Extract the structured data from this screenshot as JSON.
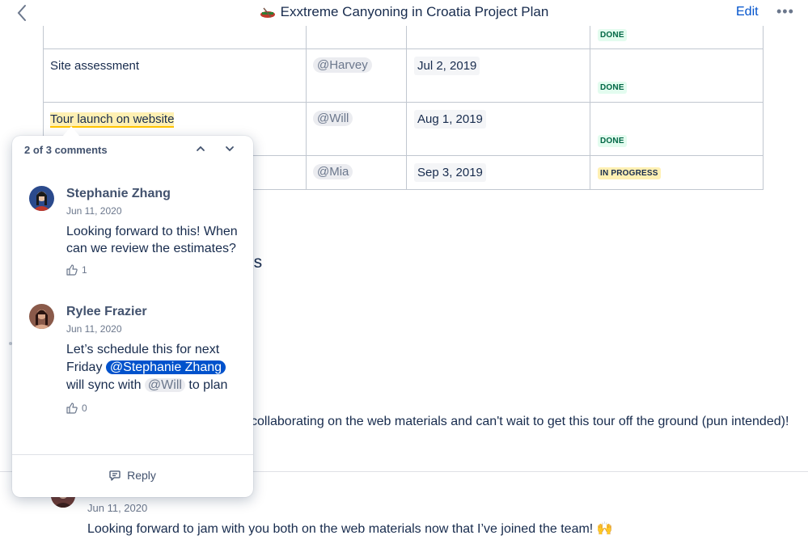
{
  "header": {
    "title": "Exxtreme Canyoning in Croatia Project Plan",
    "edit_label": "Edit",
    "more_label": "•••"
  },
  "table": {
    "rows": [
      {
        "task": "",
        "owner": "",
        "date": "",
        "status": "DONE"
      },
      {
        "task": "Site assessment",
        "owner": "@Harvey",
        "date": "Jul 2, 2019",
        "status": "DONE"
      },
      {
        "task": "Tour launch on website",
        "owner": "@Will",
        "date": "Aug 1, 2019",
        "status": "DONE"
      },
      {
        "task": "",
        "owner": "@Mia",
        "date": "Sep 3, 2019",
        "status": "IN PROGRESS"
      }
    ]
  },
  "page": {
    "partial_heading": "ls",
    "body_line": "collaborating on the web materials and can't wait to get this tour off the ground (pun intended)!",
    "bottom_comment": {
      "date": "Jun 11, 2020",
      "text": "Looking forward to jam with you both on the web materials now that I’ve joined the team! 🙌"
    }
  },
  "comments_panel": {
    "counter": "2 of 3 comments",
    "comments": [
      {
        "author": "Stephanie Zhang",
        "date": "Jun 11, 2020",
        "text": "Looking forward to this! When can we review the estimates?",
        "likes": "1"
      },
      {
        "author": "Rylee Frazier",
        "date": "Jun 11, 2020",
        "text_part1": "Let’s schedule this for next Friday",
        "mention1": "@Stephanie Zhang",
        "text_part2": "will sync with",
        "mention2": "@Will",
        "text_part3": "to plan",
        "likes": "0"
      }
    ],
    "reply_label": "Reply"
  },
  "colors": {
    "accent": "#0052cc",
    "done_bg": "#e3fcef",
    "done_text": "#006644",
    "in_progress_bg": "#fff0b3"
  },
  "icons": [
    "chevron-left-icon",
    "raft-emoji-icon",
    "more-icon",
    "chevron-up-icon",
    "chevron-down-icon",
    "thumbs-up-icon",
    "comment-icon"
  ]
}
